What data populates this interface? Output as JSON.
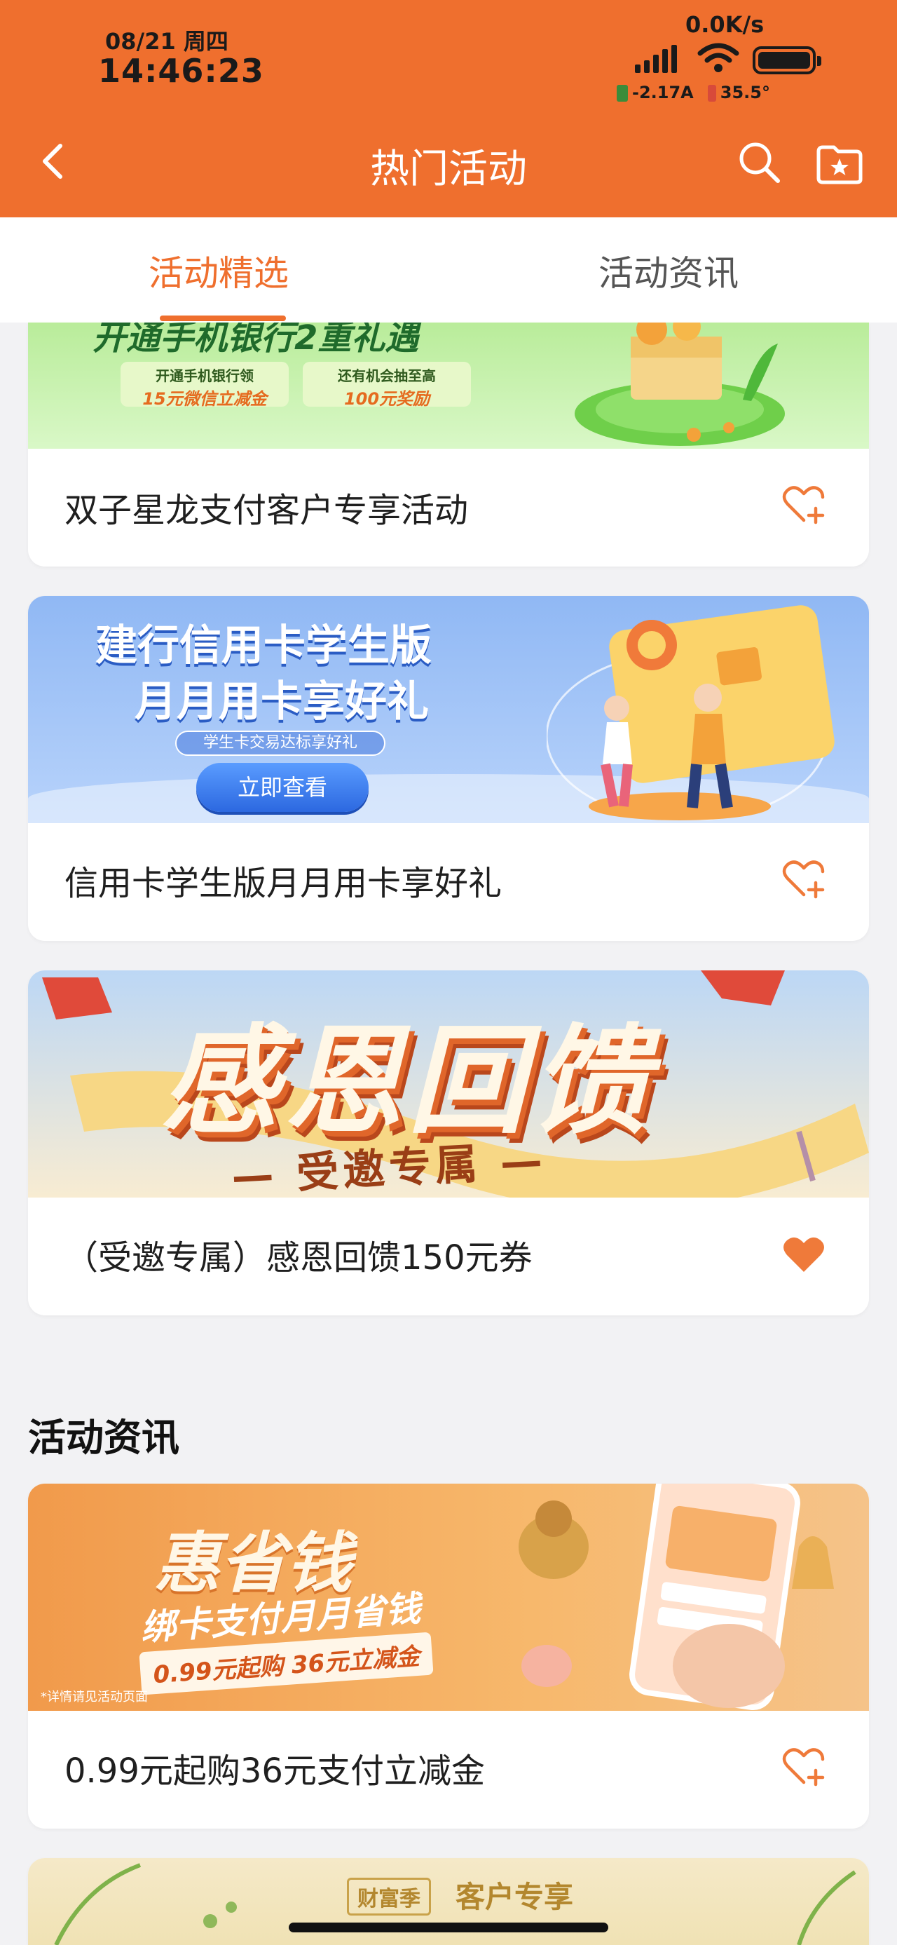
{
  "status": {
    "date": "08/21 周四",
    "time": "14:46:23",
    "speed": "0.0K/s",
    "current": "-2.17A",
    "temperature": "35.5°"
  },
  "nav": {
    "title": "热门活动"
  },
  "tabs": [
    {
      "label": "活动精选",
      "active": true
    },
    {
      "label": "活动资讯",
      "active": false
    }
  ],
  "cards": [
    {
      "banner": {
        "headline": "开通手机银行2重礼遇",
        "line1": "开通手机银行领",
        "line1b": "15元微信立减金",
        "line2": "还有机会抽至高",
        "line2b": "100元奖励"
      },
      "label": "双子星龙支付客户专享活动",
      "favorited": false
    },
    {
      "banner": {
        "headline1": "建行信用卡学生版",
        "headline2": "月月用卡享好礼",
        "sub": "学生卡交易达标享好礼",
        "button": "立即查看"
      },
      "label": "信用卡学生版月月用卡享好礼",
      "favorited": false
    },
    {
      "banner": {
        "headline": "感恩回馈",
        "sub": "— 受邀专属 —"
      },
      "label": "（受邀专属）感恩回馈150元券",
      "favorited": true
    }
  ],
  "section": {
    "title": "活动资讯"
  },
  "news": [
    {
      "banner": {
        "headline": "惠省钱",
        "sub": "绑卡支付月月省钱",
        "price": "0.99元起购 36元立减金",
        "note": "*详情请见活动页面"
      },
      "label": "0.99元起购36元支付立减金",
      "favorited": false
    },
    {
      "banner": {
        "tag": "财富季",
        "headline": "客户专享"
      }
    }
  ],
  "colors": {
    "brand": "#ef6f2e",
    "heart": "#ef7a3a"
  }
}
